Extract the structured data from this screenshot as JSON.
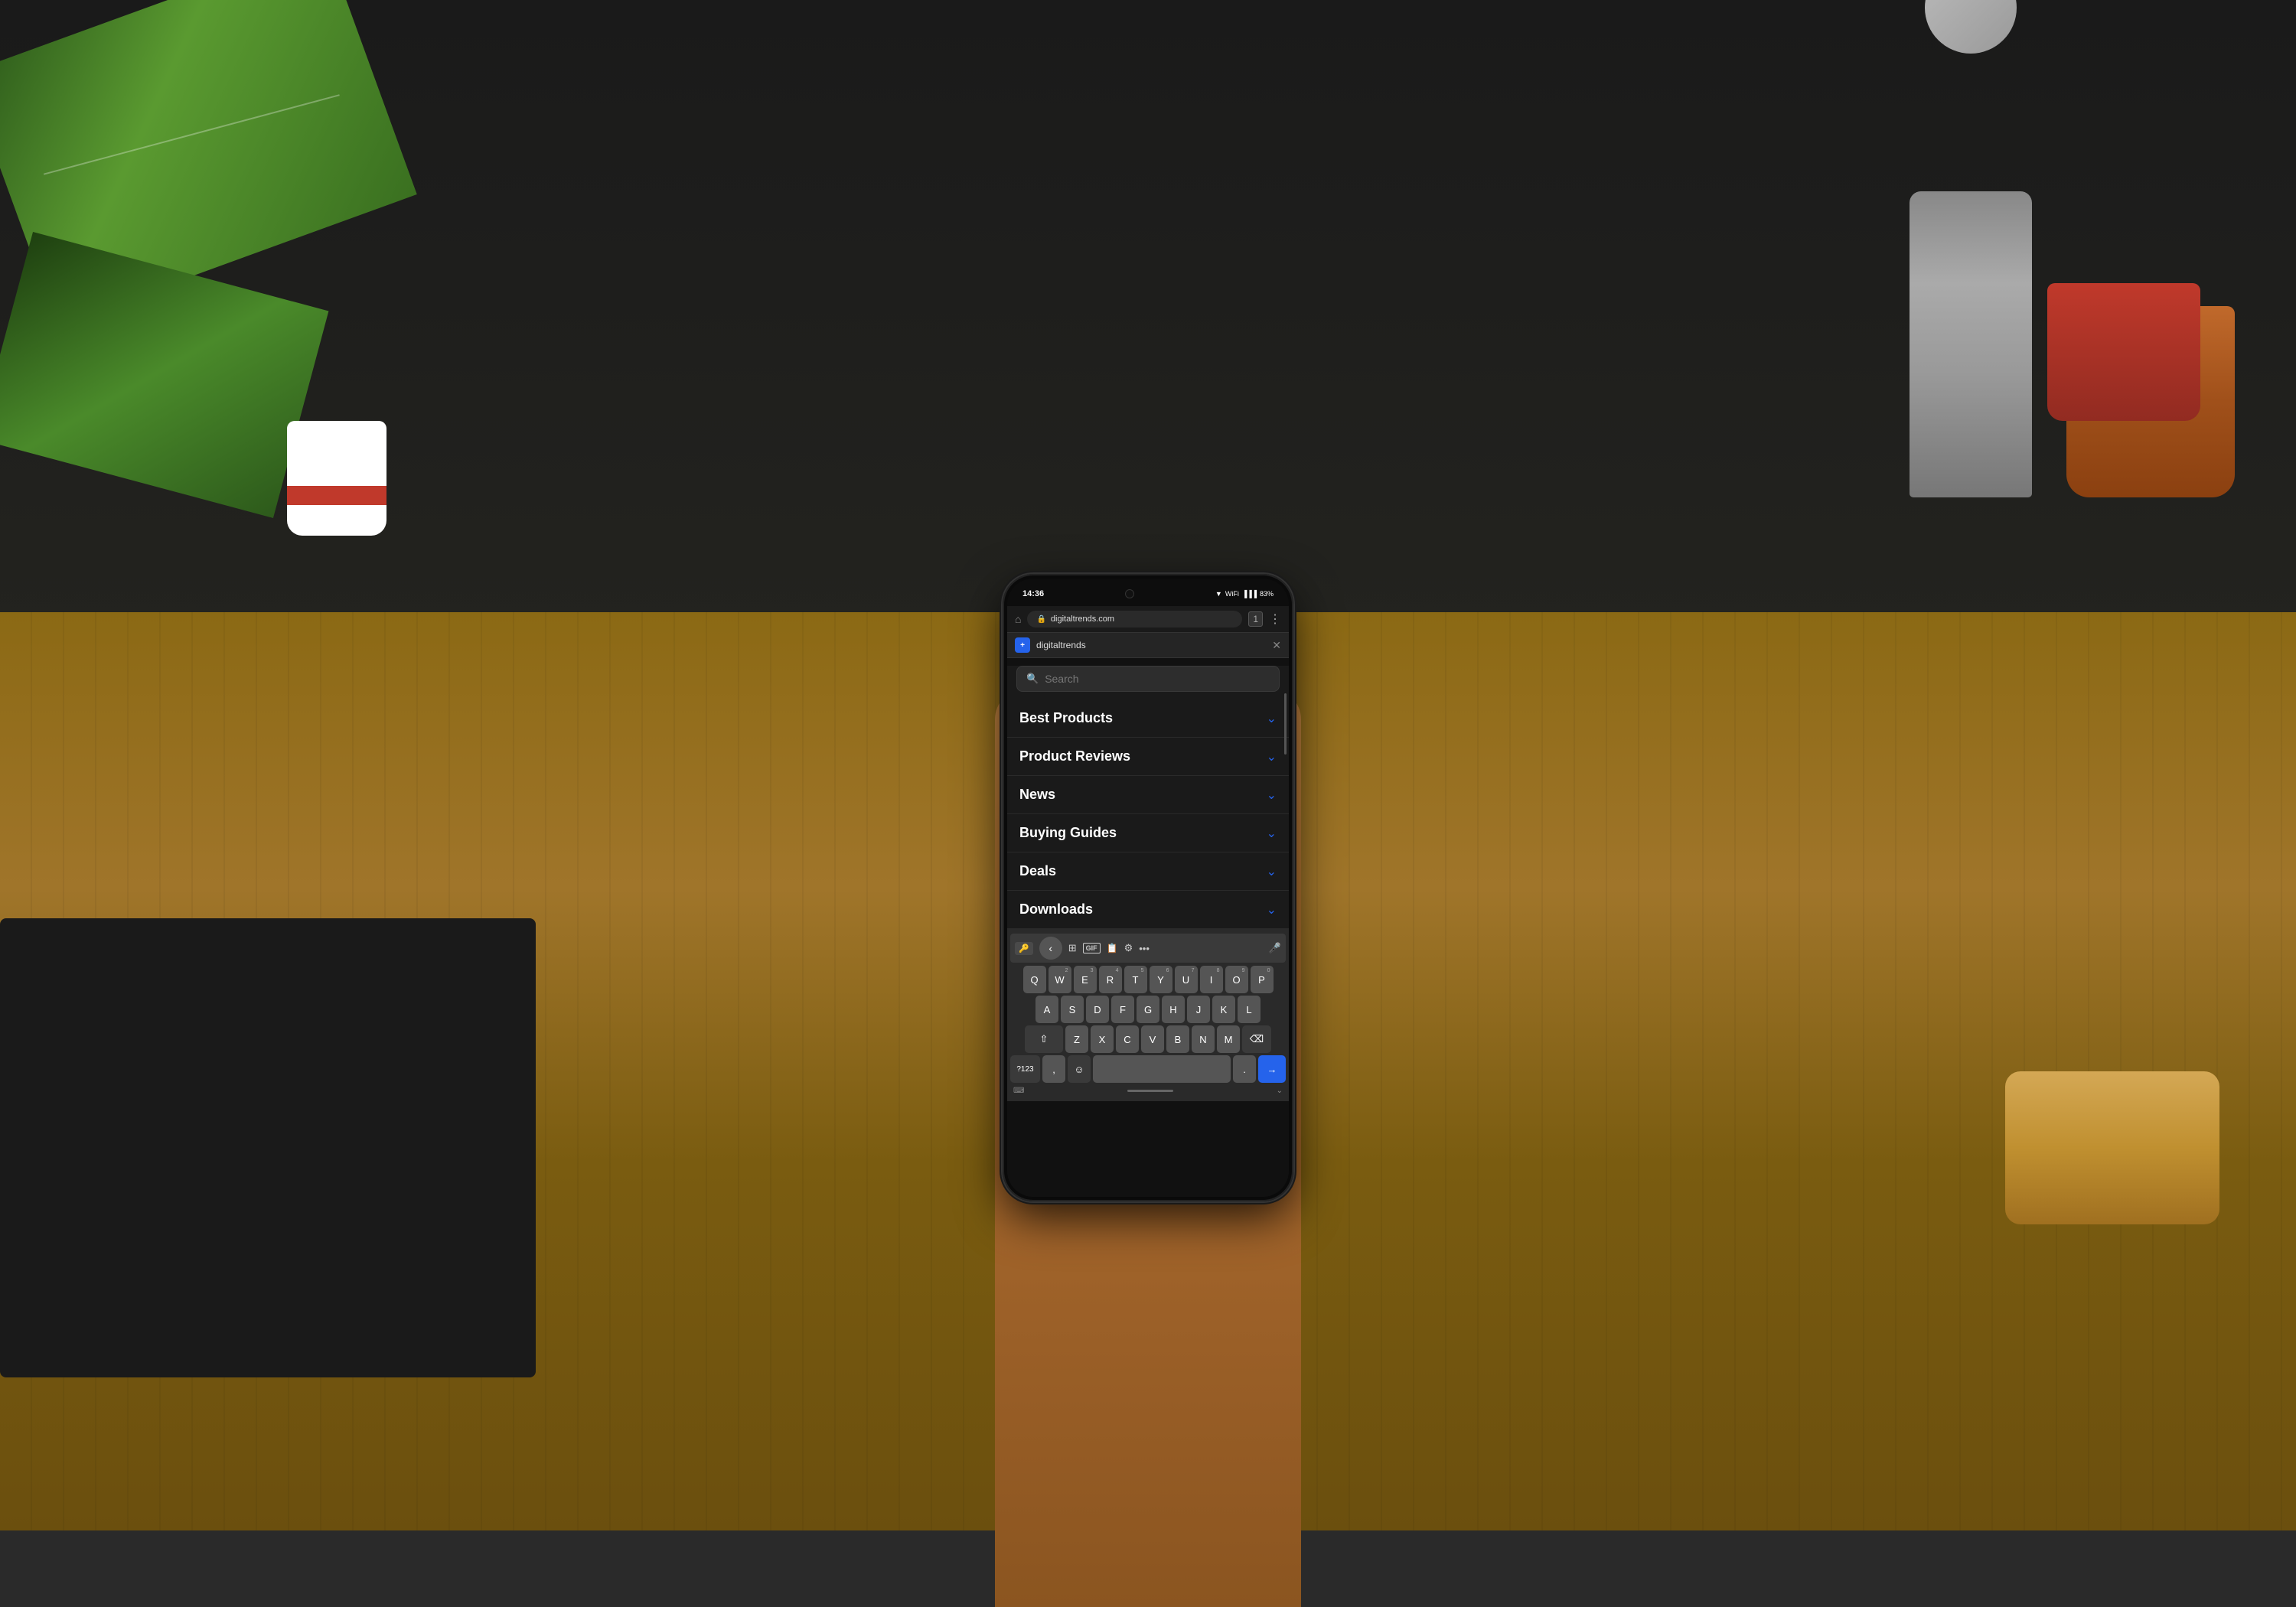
{
  "scene": {
    "bg_color": "#2a2a2a"
  },
  "status_bar": {
    "time": "14:36",
    "battery": "83%",
    "icons": "▼ WiFi Signal"
  },
  "browser": {
    "url": "digitaltrends.com",
    "tab_title": "digitaltrends",
    "tab_icon_text": "+",
    "home_icon": "⌂",
    "lock_icon": "🔒",
    "tabs_label": "1",
    "menu_dots": "⋮",
    "close_tab": "✕"
  },
  "menu": {
    "search_placeholder": "Search",
    "items": [
      {
        "label": "Best Products",
        "has_chevron": true
      },
      {
        "label": "Product Reviews",
        "has_chevron": true
      },
      {
        "label": "News",
        "has_chevron": true
      },
      {
        "label": "Buying Guides",
        "has_chevron": true
      },
      {
        "label": "Deals",
        "has_chevron": true
      },
      {
        "label": "Downloads",
        "has_chevron": true
      }
    ]
  },
  "keyboard": {
    "toolbar": {
      "back_label": "‹",
      "sticker_icon": "⊞",
      "gif_label": "GIF",
      "clipboard_icon": "📋",
      "settings_icon": "⚙",
      "more_icon": "•••",
      "mic_icon": "🎤"
    },
    "rows": [
      {
        "keys": [
          {
            "label": "Q",
            "sup": ""
          },
          {
            "label": "W",
            "sup": "2"
          },
          {
            "label": "E",
            "sup": "3"
          },
          {
            "label": "R",
            "sup": "4"
          },
          {
            "label": "T",
            "sup": "5"
          },
          {
            "label": "Y",
            "sup": "6"
          },
          {
            "label": "U",
            "sup": "7"
          },
          {
            "label": "I",
            "sup": "8"
          },
          {
            "label": "O",
            "sup": "9"
          },
          {
            "label": "P",
            "sup": "0"
          }
        ]
      },
      {
        "keys": [
          {
            "label": "A"
          },
          {
            "label": "S"
          },
          {
            "label": "D"
          },
          {
            "label": "F"
          },
          {
            "label": "G"
          },
          {
            "label": "H"
          },
          {
            "label": "J"
          },
          {
            "label": "K"
          },
          {
            "label": "L"
          }
        ]
      },
      {
        "keys": [
          {
            "label": "⇧",
            "special": "shift"
          },
          {
            "label": "Z"
          },
          {
            "label": "X"
          },
          {
            "label": "C"
          },
          {
            "label": "V"
          },
          {
            "label": "B"
          },
          {
            "label": "N"
          },
          {
            "label": "M"
          },
          {
            "label": "⌫",
            "special": "delete"
          }
        ]
      },
      {
        "keys": [
          {
            "label": "?123",
            "special": "symbol"
          },
          {
            "label": ","
          },
          {
            "label": "☺",
            "special": "emoji"
          },
          {
            "label": "",
            "special": "space"
          },
          {
            "label": "."
          },
          {
            "label": "→",
            "special": "action"
          }
        ]
      }
    ],
    "bottom_bar": {
      "keyboard_icon": "⌨",
      "chevron_down": "⌄"
    }
  },
  "accent_color": "#2563eb",
  "bg_dark": "#1a1a1a",
  "phone_bg": "#111111"
}
